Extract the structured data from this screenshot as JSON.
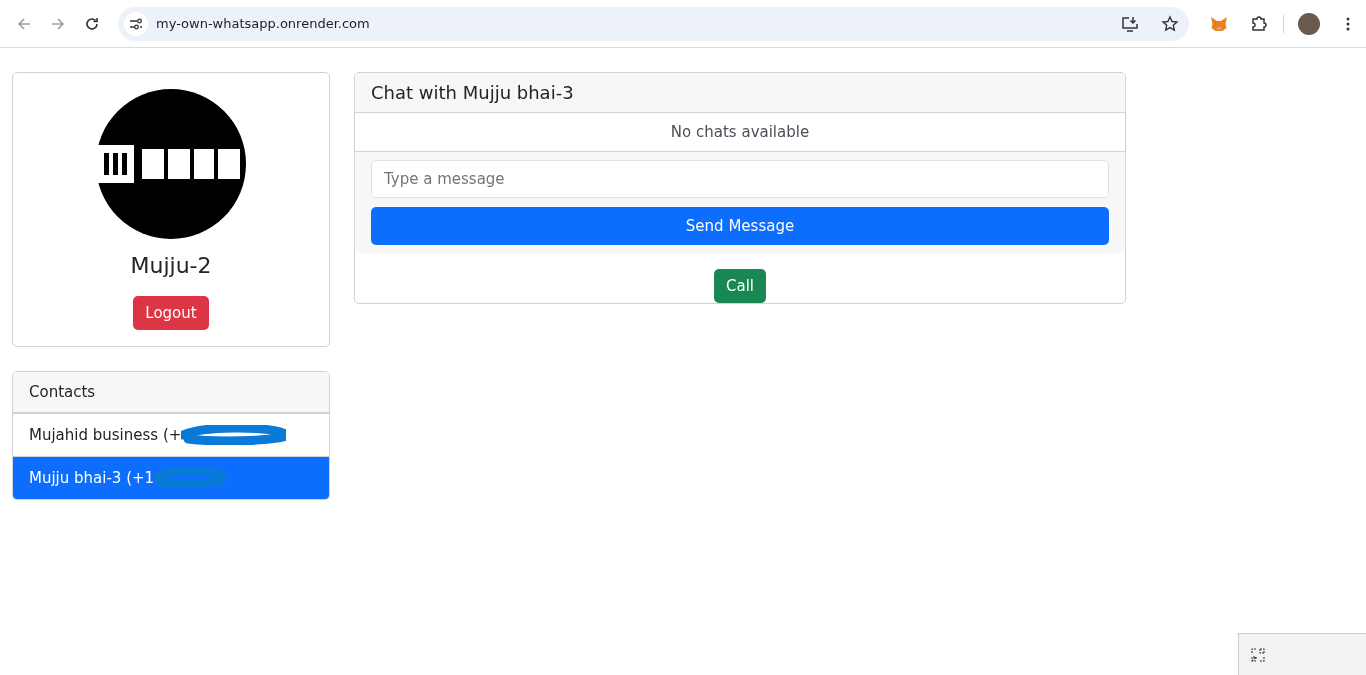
{
  "browser": {
    "url": "my-own-whatsapp.onrender.com"
  },
  "profile": {
    "name": "Mujju-2",
    "logout": "Logout"
  },
  "contacts": {
    "title": "Contacts",
    "items": [
      {
        "label": "Mujahid business (+",
        "selected": false
      },
      {
        "label": "Mujju bhai-3 (+1",
        "selected": true
      }
    ]
  },
  "chat": {
    "title": "Chat with Mujju bhai-3",
    "empty": "No chats available",
    "input_placeholder": "Type a message",
    "send": "Send Message",
    "call": "Call"
  }
}
